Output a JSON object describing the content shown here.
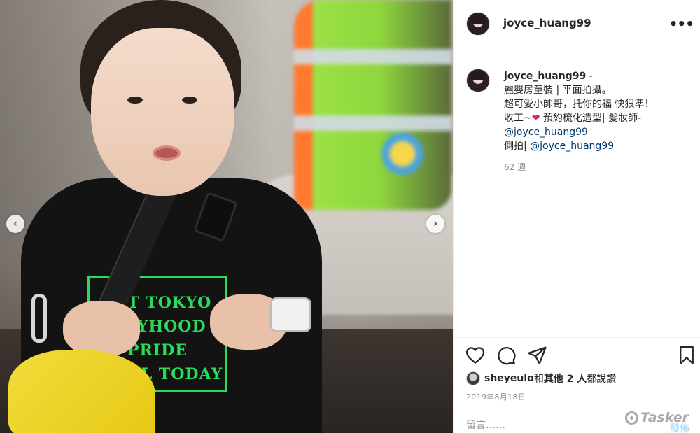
{
  "post": {
    "username": "joyce_huang99",
    "more_glyph": "•••",
    "photo": {
      "shirt_print_lines": [
        "EST TOKYO",
        "BOYHOOD",
        "PRIDE",
        "UNTIL TODAY"
      ],
      "nav_prev_glyph": "‹",
      "nav_next_glyph": "›"
    }
  },
  "caption": {
    "author": "joyce_huang99",
    "separator": " -",
    "line1": "麗嬰房童裝 | 平面拍攝。",
    "line2": "超可愛小帥哥，托你的福 快狠準！",
    "line3_before": "收工~",
    "heart": "❤",
    "line3_after": " 預約梳化造型| 髮妝師-",
    "mention1": "@joyce_huang99",
    "line5_before": "側拍| ",
    "mention2": "@joyce_huang99",
    "time_ago": "62 週"
  },
  "actions": {
    "liked_by_user": "sheyeulo",
    "liked_by_mid": " 和 ",
    "liked_by_others": "其他 2 人",
    "liked_by_suffix": " 都說讚",
    "date": "2019年8月18日",
    "comment_placeholder": "留言……",
    "post_label": "發佈"
  },
  "watermark": {
    "text": "Tasker"
  },
  "colors": {
    "accent_link": "#00376b",
    "post_button_disabled": "#b2dffc",
    "heart": "#e0245e",
    "shirt_print": "#2bdc5b"
  }
}
